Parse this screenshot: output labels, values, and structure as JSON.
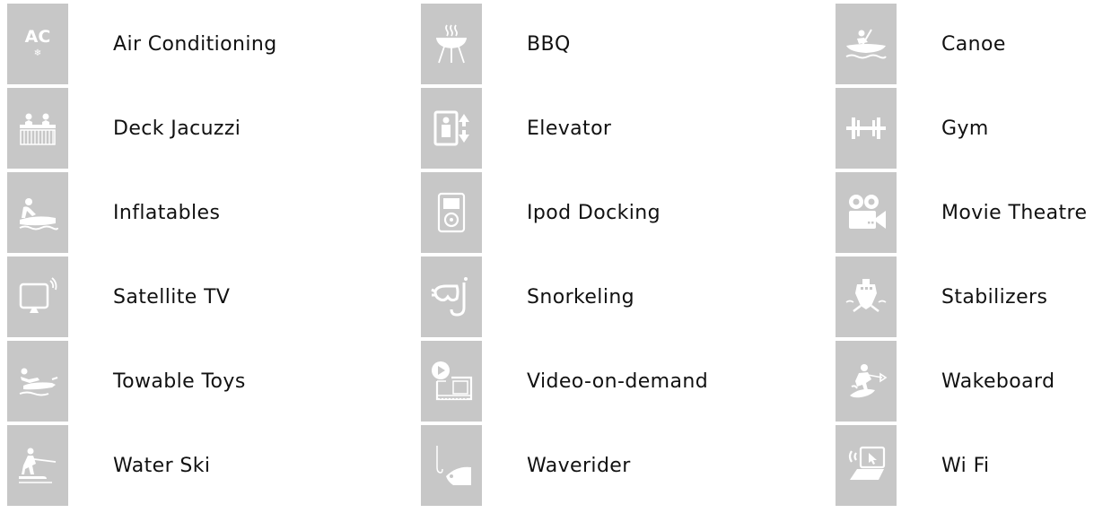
{
  "amenities": {
    "columns": [
      [
        {
          "label": "Air Conditioning",
          "icon": "air-conditioning-icon"
        },
        {
          "label": "Deck Jacuzzi",
          "icon": "jacuzzi-icon"
        },
        {
          "label": "Inflatables",
          "icon": "inflatables-icon"
        },
        {
          "label": "Satellite TV",
          "icon": "satellite-tv-icon"
        },
        {
          "label": "Towable Toys",
          "icon": "towable-toys-icon"
        },
        {
          "label": "Water Ski",
          "icon": "water-ski-icon"
        }
      ],
      [
        {
          "label": "BBQ",
          "icon": "bbq-icon"
        },
        {
          "label": "Elevator",
          "icon": "elevator-icon"
        },
        {
          "label": "Ipod Docking",
          "icon": "ipod-icon"
        },
        {
          "label": "Snorkeling",
          "icon": "snorkel-icon"
        },
        {
          "label": "Video-on-demand",
          "icon": "video-on-demand-icon"
        },
        {
          "label": "Waverider",
          "icon": "waverider-icon"
        }
      ],
      [
        {
          "label": "Canoe",
          "icon": "canoe-icon"
        },
        {
          "label": "Gym",
          "icon": "gym-icon"
        },
        {
          "label": "Movie Theatre",
          "icon": "movie-camera-icon"
        },
        {
          "label": "Stabilizers",
          "icon": "stabilizers-icon"
        },
        {
          "label": "Wakeboard",
          "icon": "wakeboard-icon"
        },
        {
          "label": "Wi Fi",
          "icon": "wifi-laptop-icon"
        }
      ]
    ]
  },
  "colors": {
    "tile_background": "#c7c7c7",
    "icon": "#ffffff",
    "text": "#111111"
  }
}
